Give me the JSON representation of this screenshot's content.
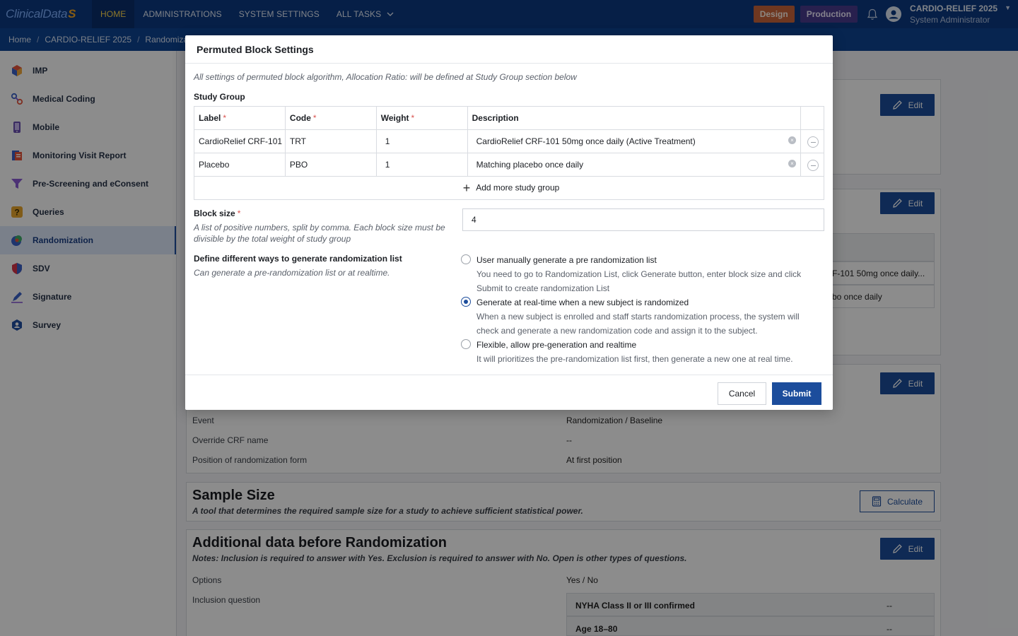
{
  "topnav": {
    "logo_text": "ClinicalData",
    "logo_mark": "S",
    "items": [
      "HOME",
      "ADMINISTRATIONS",
      "SYSTEM SETTINGS",
      "ALL TASKS"
    ],
    "active": "HOME",
    "badges": {
      "design": "Design",
      "production": "Production"
    },
    "study_name": "CARDIO-RELIEF 2025",
    "user_role": "System Administrator"
  },
  "breadcrumb": [
    "Home",
    "CARDIO-RELIEF 2025",
    "Randomiza"
  ],
  "sidebar": {
    "items": [
      {
        "label": "IMP",
        "icon": "cube-icon"
      },
      {
        "label": "Medical Coding",
        "icon": "coding-icon"
      },
      {
        "label": "Mobile",
        "icon": "mobile-icon"
      },
      {
        "label": "Monitoring Visit Report",
        "icon": "report-icon"
      },
      {
        "label": "Pre-Screening and eConsent",
        "icon": "funnel-icon"
      },
      {
        "label": "Queries",
        "icon": "question-icon"
      },
      {
        "label": "Randomization",
        "icon": "randomization-icon"
      },
      {
        "label": "SDV",
        "icon": "shield-icon"
      },
      {
        "label": "Signature",
        "icon": "pen-icon"
      },
      {
        "label": "Survey",
        "icon": "survey-icon"
      }
    ],
    "active_index": 6
  },
  "background": {
    "edit_label": "Edit",
    "calculate_label": "Calculate",
    "table_cells": [
      "F-101 50mg once daily...",
      "bo once daily"
    ],
    "form_rows": [
      {
        "label": "Event",
        "value": "Randomization / Baseline"
      },
      {
        "label": "Override CRF name",
        "value": "--"
      },
      {
        "label": "Position of randomization form",
        "value": "At first position"
      }
    ],
    "sample_size": {
      "title": "Sample Size",
      "subtitle": "A tool that determines the required sample size for a study to achieve sufficient statistical power."
    },
    "additional": {
      "title": "Additional data before Randomization",
      "subtitle": "Notes: Inclusion is required to answer with Yes. Exclusion is required to answer with No. Open is other types of questions.",
      "options_label": "Options",
      "options_value": "Yes / No",
      "inclusion_label": "Inclusion question",
      "questions": [
        {
          "text": "NYHA Class II or III confirmed",
          "answer": "--"
        },
        {
          "text": "Age 18–80",
          "answer": "--"
        }
      ]
    }
  },
  "modal": {
    "title": "Permuted Block Settings",
    "note": "All settings of permuted block algorithm, Allocation Ratio: will be defined at Study Group section below",
    "study_group_label": "Study Group",
    "columns": {
      "label": "Label",
      "code": "Code",
      "weight": "Weight",
      "description": "Description"
    },
    "rows": [
      {
        "label": "CardioRelief CRF-101",
        "code": "TRT",
        "weight": "1",
        "description": "CardioRelief CRF-101 50mg once daily (Active Treatment)"
      },
      {
        "label": "Placebo",
        "code": "PBO",
        "weight": "1",
        "description": "Matching placebo once daily"
      }
    ],
    "add_more": "Add more study group",
    "block_size": {
      "label": "Block size",
      "hint": "A list of positive numbers, split by comma. Each block size must be divisible by the total weight of study group",
      "value": "4"
    },
    "generation": {
      "label": "Define different ways to generate randomization list",
      "hint": "Can generate a pre-randomization list or at realtime.",
      "options": [
        {
          "title": "User manually generate a pre randomization list",
          "desc": "You need to go to Randomization List, click Generate button, enter block size and click Submit to create randomization List",
          "selected": false
        },
        {
          "title": "Generate at real-time when a new subject is randomized",
          "desc": "When a new subject is enrolled and staff starts randomization process, the system will check and generate a new randomization code and assign it to the subject.",
          "selected": true
        },
        {
          "title": "Flexible, allow pre-generation and realtime",
          "desc": "It will prioritizes the pre-randomization list first, then generate a new one at real time.",
          "selected": false
        }
      ]
    },
    "cancel_label": "Cancel",
    "submit_label": "Submit"
  }
}
